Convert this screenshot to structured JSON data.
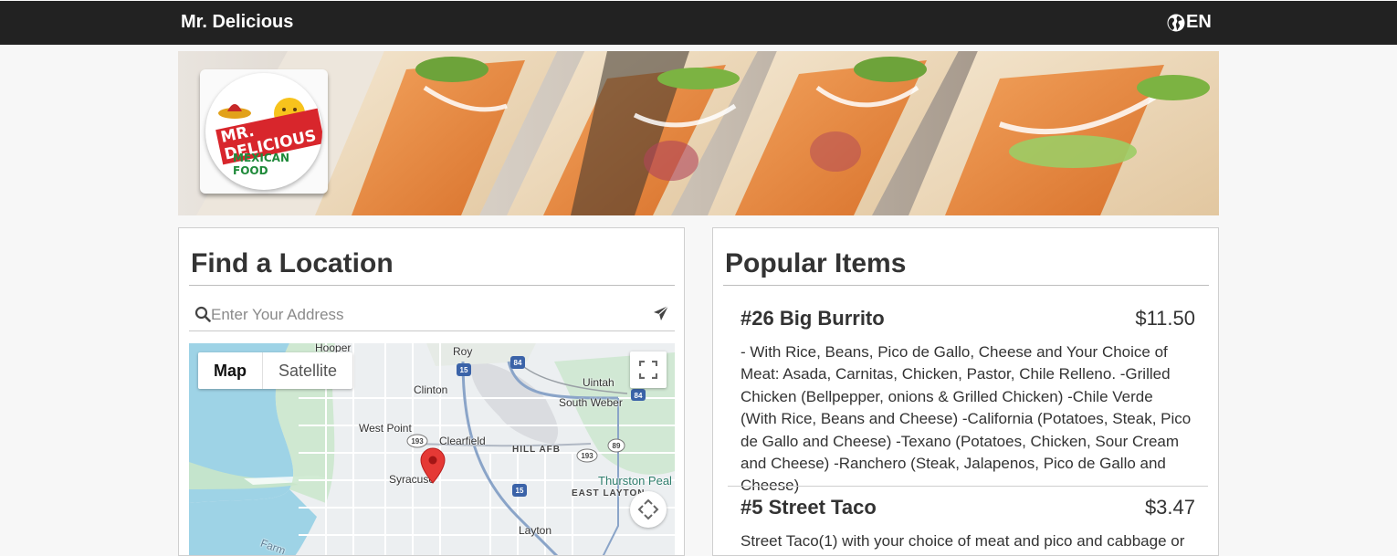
{
  "header": {
    "brand": "Mr. Delicious",
    "language_label": "EN",
    "language_icon": "globe-icon"
  },
  "hero": {
    "logo_line1": "MR. DELICIOUS",
    "logo_line2": "MEXICAN FOOD"
  },
  "find_location": {
    "title": "Find a Location",
    "search_placeholder": "Enter Your Address",
    "search_value": "",
    "map": {
      "map_label": "Map",
      "satellite_label": "Satellite",
      "selected_type": "Map",
      "places": [
        "Hooper",
        "Roy",
        "Clinton",
        "Uintah",
        "South Weber",
        "West Point",
        "Clearfield",
        "HILL AFB",
        "Syracuse",
        "Thurston Peal",
        "EAST LAYTON",
        "Layton",
        "Farm"
      ],
      "route_shields": [
        "84",
        "15",
        "84",
        "193",
        "193",
        "89",
        "15"
      ]
    }
  },
  "popular_items": {
    "title": "Popular Items",
    "items": [
      {
        "name": "#26 Big Burrito",
        "price": "$11.50",
        "description": "- With Rice, Beans, Pico de Gallo, Cheese and Your Choice of Meat: Asada, Carnitas, Chicken, Pastor, Chile Relleno. -Grilled Chicken (Bellpepper, onions & Grilled Chicken) -Chile Verde (With Rice, Beans and Cheese) -California (Potatoes, Steak, Pico de Gallo and Cheese) -Texano (Potatoes, Chicken, Sour Cream and Cheese) -Ranchero (Steak, Jalapenos, Pico de Gallo and Cheese)"
      },
      {
        "name": "#5 Street Taco",
        "price": "$3.47",
        "description": "Street Taco(1) with your choice of meat and pico and cabbage or"
      }
    ]
  },
  "colors": {
    "topbar": "#222222",
    "pin": "#e53935",
    "map_water": "#9ed3e6",
    "map_park": "#c8e6c9"
  }
}
